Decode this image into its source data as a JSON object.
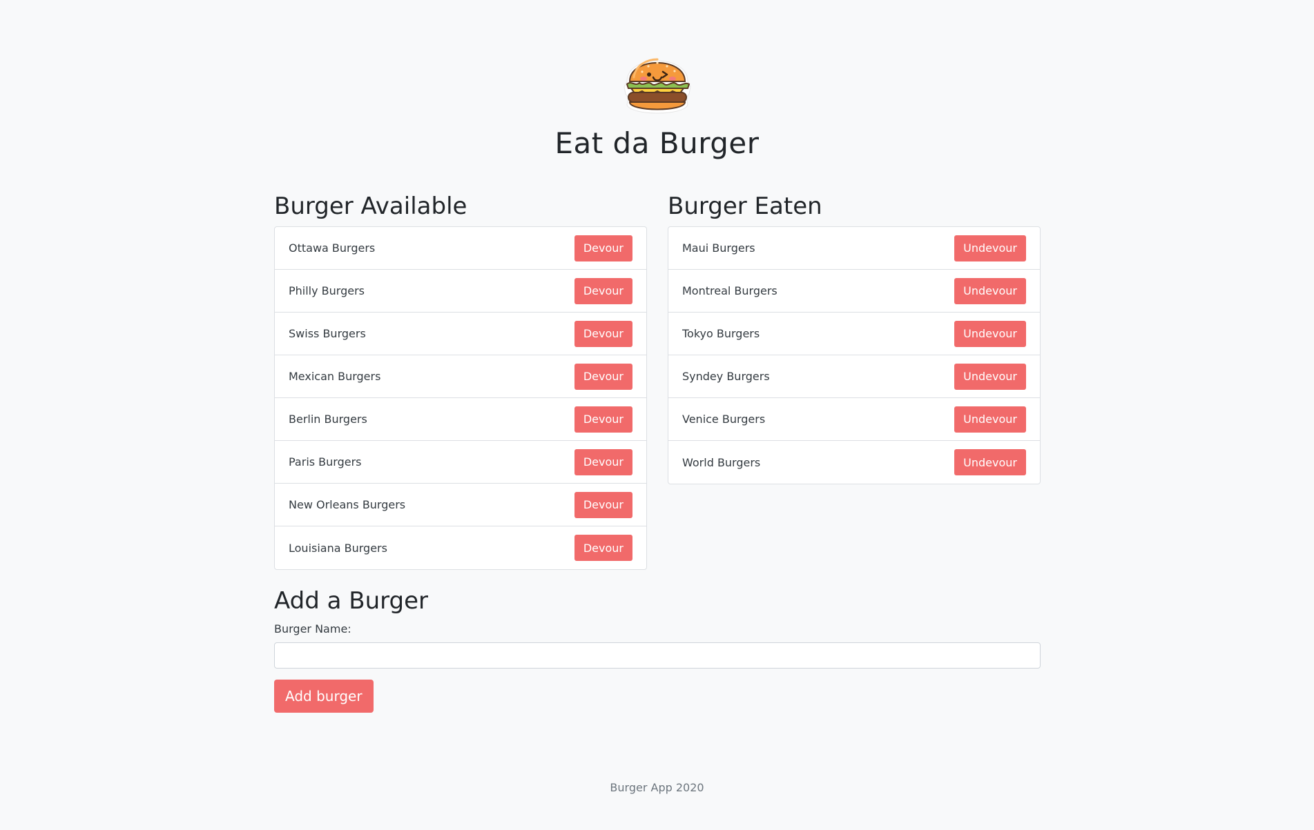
{
  "header": {
    "title": "Eat da Burger",
    "logo_icon": "burger-mascot-icon"
  },
  "available": {
    "title": "Burger Available",
    "button_label": "Devour",
    "items": [
      "Ottawa Burgers",
      "Philly Burgers",
      "Swiss Burgers",
      "Mexican Burgers",
      "Berlin Burgers",
      "Paris Burgers",
      "New Orleans Burgers",
      "Louisiana Burgers"
    ]
  },
  "eaten": {
    "title": "Burger Eaten",
    "button_label": "Undevour",
    "items": [
      "Maui Burgers",
      "Montreal Burgers",
      "Tokyo Burgers",
      "Syndey Burgers",
      "Venice Burgers",
      "World Burgers"
    ]
  },
  "add_form": {
    "title": "Add a Burger",
    "label": "Burger Name:",
    "input_value": "",
    "submit_label": "Add burger"
  },
  "footer": {
    "text": "Burger App 2020"
  },
  "colors": {
    "accent": "#f16a6a",
    "background": "#f8f9fa"
  }
}
